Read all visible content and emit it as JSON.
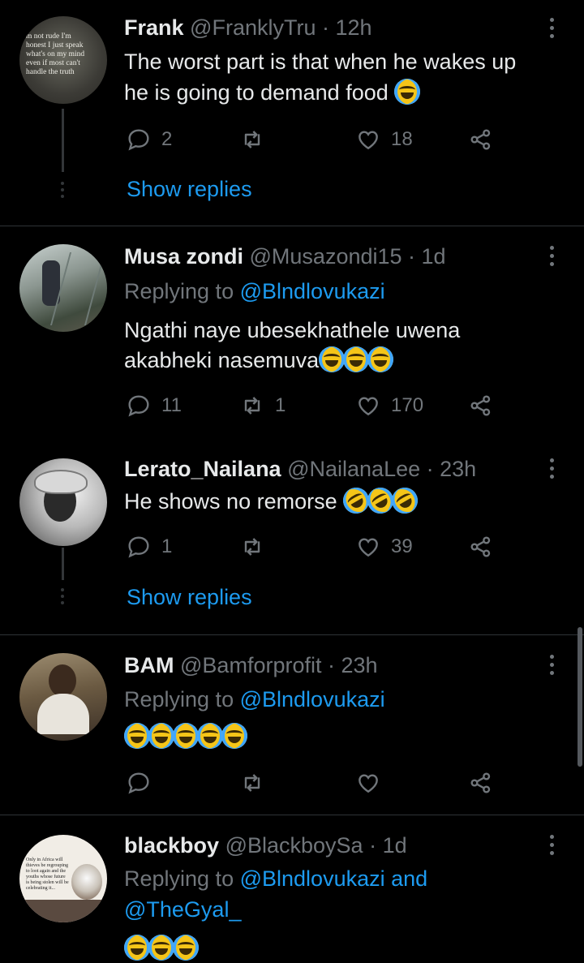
{
  "tweets": [
    {
      "name": "Frank",
      "handle": "@FranklyTru",
      "time": "· 12h",
      "avatar_text": [
        "m not rude I'm",
        "honest I just speak",
        "what's on my mind",
        "even if most can't",
        "handle the truth"
      ],
      "text_lines": [
        "The worst part is that when he wakes up",
        "he is going to demand food"
      ],
      "replies": "2",
      "retweets": "",
      "likes": "18",
      "show_replies": "Show replies"
    },
    {
      "name": "Musa zondi",
      "handle": "@Musazondi15",
      "time": "· 1d",
      "replying_prefix": "Replying to",
      "replying_to": "@Blndlovukazi",
      "text_lines": [
        "Ngathi naye ubesekhathele uwena",
        "akabheki nasemuva"
      ],
      "replies": "11",
      "retweets": "1",
      "likes": "170"
    },
    {
      "name": "Lerato_Nailana",
      "handle": "@NailanaLee",
      "time": "· 23h",
      "text_lines": [
        "He shows no remorse"
      ],
      "replies": "1",
      "retweets": "",
      "likes": "39",
      "show_replies": "Show replies"
    },
    {
      "name": "BAM",
      "handle": "@Bamforprofit",
      "time": "· 23h",
      "replying_prefix": "Replying to",
      "replying_to": "@Blndlovukazi",
      "replies": "",
      "retweets": "",
      "likes": ""
    },
    {
      "name": "blackboy",
      "handle": "@BlackboySa",
      "time": "· 1d",
      "replying_prefix": "Replying to",
      "replying_to": "@Blndlovukazi and",
      "replying_to_2": "@TheGyal_",
      "avatar_text": [
        "Only in Africa will",
        "thieves be regrouping",
        "to loot again and the",
        "youths whose future",
        "is being stolen will be",
        "celebrating it..."
      ]
    }
  ],
  "colors": {
    "background": "#000000",
    "text": "#e7e9ea",
    "muted": "#71767b",
    "link": "#1d9bf0",
    "divider": "#2f3336"
  },
  "icons": [
    "reply-icon",
    "retweet-icon",
    "like-icon",
    "share-icon",
    "more-icon"
  ]
}
